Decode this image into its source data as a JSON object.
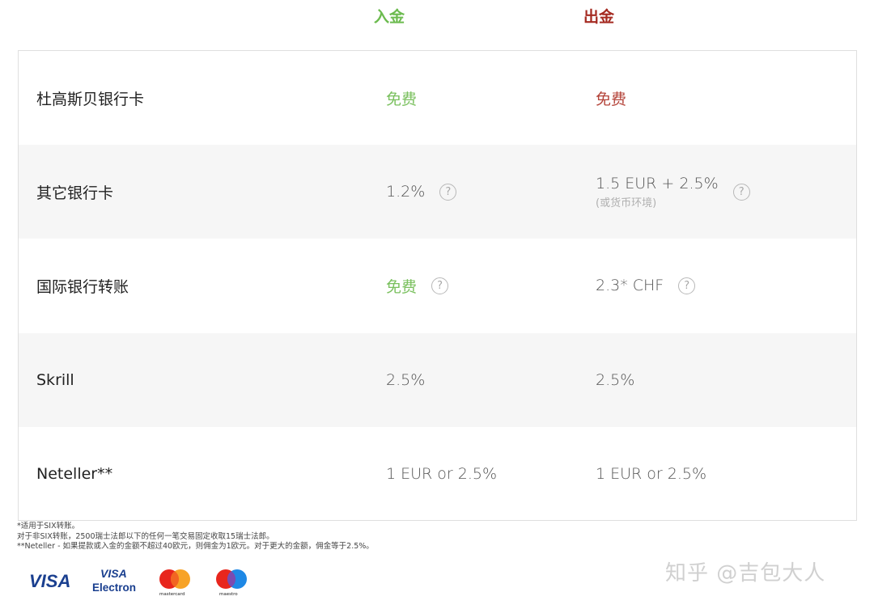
{
  "header": {
    "deposit_label": "入金",
    "withdraw_label": "出金",
    "colors": {
      "deposit": "#6cbb4f",
      "withdraw": "#a52b22"
    }
  },
  "rows": [
    {
      "name": "杜高斯贝银行卡",
      "deposit": "免费",
      "withdraw": "免费",
      "withdraw_note": "",
      "deposit_help": false,
      "withdraw_help": false
    },
    {
      "name": "其它银行卡",
      "deposit": "1.2%",
      "withdraw": "1.5 EUR + 2.5%",
      "withdraw_note": "(或货币环境)",
      "deposit_help": true,
      "withdraw_help": true
    },
    {
      "name": "国际银行转账",
      "deposit": "免费",
      "withdraw": "2.3* CHF",
      "withdraw_note": "",
      "deposit_help": true,
      "withdraw_help": true
    },
    {
      "name": "Skrill",
      "deposit": "2.5%",
      "withdraw": "2.5%",
      "withdraw_note": "",
      "deposit_help": false,
      "withdraw_help": false
    },
    {
      "name": "Neteller**",
      "deposit": "1 EUR or 2.5%",
      "withdraw": "1 EUR or 2.5%",
      "withdraw_note": "",
      "deposit_help": false,
      "withdraw_help": false
    }
  ],
  "help_glyph": "?",
  "footnotes": [
    "*适用于SIX转账。",
    "对于非SIX转账，2500瑞士法郎以下的任何一笔交易固定收取15瑞士法郎。",
    "**Neteller - 如果提款或入金的金额不超过40欧元，则佣金为1欧元。对于更大的金额，佣金等于2.5%。"
  ],
  "payment_logos": {
    "visa": "VISA",
    "visa_electron_top": "VISA",
    "visa_electron_bottom": "Electron",
    "mastercard": "mastercard",
    "maestro": "maestro"
  },
  "watermark": "知乎 @吉包大人"
}
